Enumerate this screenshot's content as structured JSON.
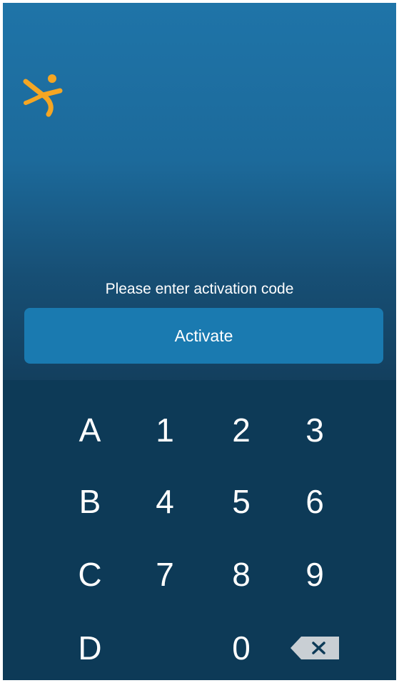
{
  "prompt": "Please enter activation code",
  "activate_label": "Activate",
  "keys": {
    "row1": [
      "A",
      "1",
      "2",
      "3"
    ],
    "row2": [
      "B",
      "4",
      "5",
      "6"
    ],
    "row3": [
      "C",
      "7",
      "8",
      "9"
    ],
    "row4": [
      "D",
      "",
      "0",
      "backspace"
    ]
  },
  "icons": {
    "logo": "running-person-icon",
    "backspace": "backspace-icon"
  },
  "colors": {
    "top_gradient_start": "#1f74a8",
    "top_gradient_end": "#133f5e",
    "button": "#1a7ab0",
    "keypad": "#0d3a57",
    "logo": "#f5a623",
    "backspace_key": "#c9cfd4"
  }
}
